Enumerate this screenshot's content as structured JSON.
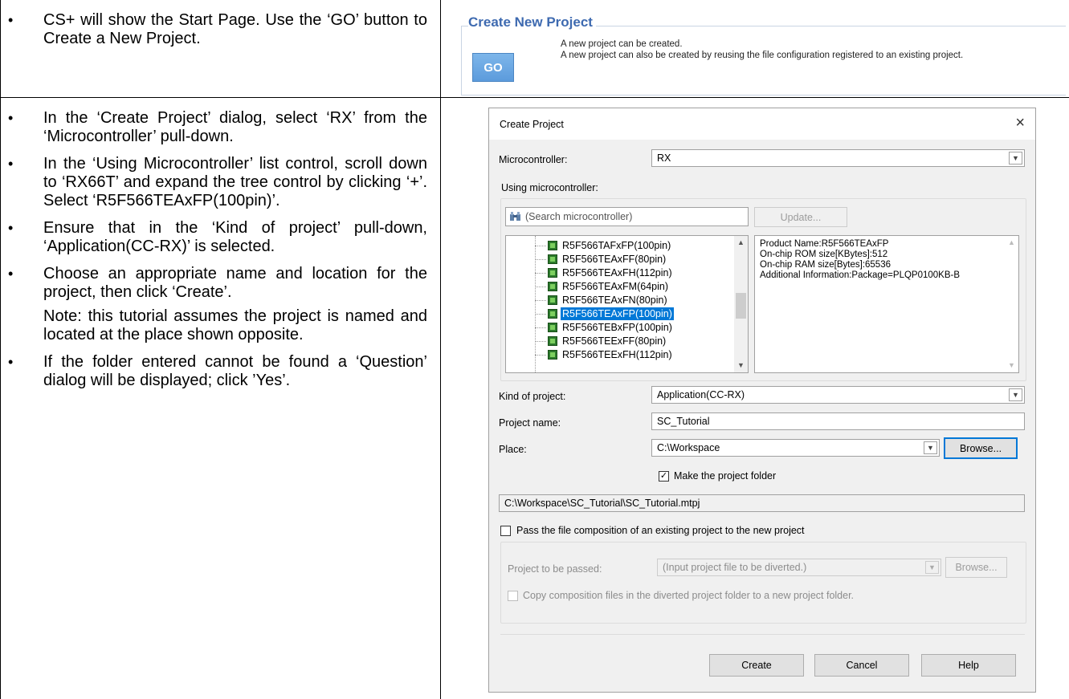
{
  "instructions": {
    "row1": [
      "CS+ will show the Start Page.  Use the ‘GO’ button to Create a New Project."
    ],
    "row2": [
      "In the ‘Create Project’ dialog, select ‘RX’ from the ‘Microcontroller’ pull-down.",
      "In the ‘Using Microcontroller’ list control, scroll down to ‘RX66T’ and expand the tree control by clicking ‘+’. Select ‘R5F566TEAxFP(100pin)’.",
      "Ensure that in the ‘Kind of project’ pull-down, ‘Application(CC-RX)’ is selected.",
      "Choose an appropriate name and location for the project, then click ‘Create’."
    ],
    "note": "Note: this tutorial assumes the project is named and located at the place shown opposite.",
    "row2_last": "If the folder entered cannot be found a ‘Question’ dialog will be displayed; click ’Yes’."
  },
  "start_page": {
    "title": "Create New Project",
    "go_label": "GO",
    "line1": "A new project can be created.",
    "line2": "A new project can also be created by reusing the file configuration registered to an existing project."
  },
  "dialog": {
    "title": "Create Project",
    "close_glyph": "×",
    "microcontroller_label": "Microcontroller:",
    "microcontroller_value": "RX",
    "using_mc_label": "Using microcontroller:",
    "search_placeholder": "(Search microcontroller)",
    "update_label": "Update...",
    "tree_items": [
      "R5F566TAFxFP(100pin)",
      "R5F566TEAxFF(80pin)",
      "R5F566TEAxFH(112pin)",
      "R5F566TEAxFM(64pin)",
      "R5F566TEAxFN(80pin)",
      "R5F566TEAxFP(100pin)",
      "R5F566TEBxFP(100pin)",
      "R5F566TEExFF(80pin)",
      "R5F566TEExFH(112pin)"
    ],
    "selected_index": 5,
    "info_lines": [
      "Product Name:R5F566TEAxFP",
      "On-chip ROM size[KBytes]:512",
      "On-chip RAM size[Bytes]:65536",
      "Additional Information:Package=PLQP0100KB-B"
    ],
    "kind_label": "Kind of project:",
    "kind_value": "Application(CC-RX)",
    "name_label": "Project name:",
    "name_value": "SC_Tutorial",
    "place_label": "Place:",
    "place_value": "C:\\Workspace",
    "browse_label": "Browse...",
    "make_folder_label": "Make the project folder",
    "make_folder_checked": true,
    "path_value": "C:\\Workspace\\SC_Tutorial\\SC_Tutorial.mtpj",
    "pass_label": "Pass the file composition of an existing project to the new project",
    "pass_checked": false,
    "passed_label": "Project to be passed:",
    "passed_placeholder": "(Input project file to be diverted.)",
    "browse2_label": "Browse...",
    "copy_label": "Copy composition files in the diverted project folder to a new project folder.",
    "create_label": "Create",
    "cancel_label": "Cancel",
    "help_label": "Help"
  }
}
